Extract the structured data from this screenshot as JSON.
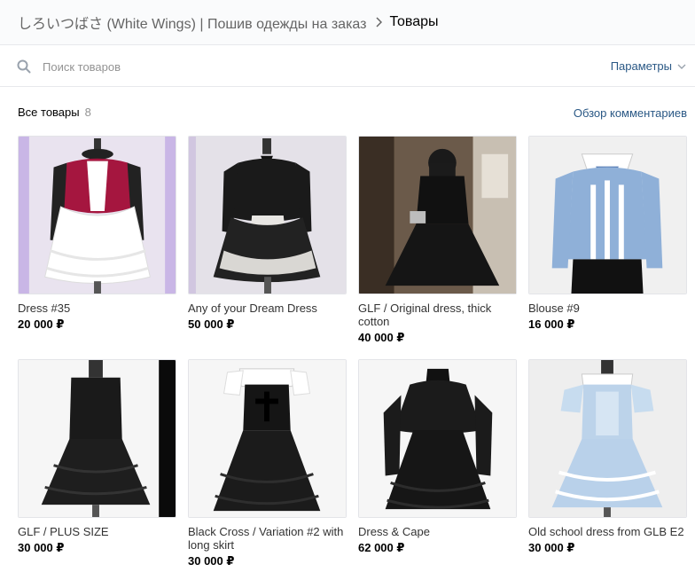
{
  "breadcrumb": {
    "group": "しろいつばさ (White Wings) | Пошив одежды на заказ",
    "current": "Товары"
  },
  "search": {
    "placeholder": "Поиск товаров",
    "params_label": "Параметры"
  },
  "section": {
    "title": "Все товары",
    "count": "8",
    "review_link": "Обзор комментариев"
  },
  "products": [
    {
      "title": "Dress #35",
      "price": "20 000 ₽"
    },
    {
      "title": "Any of your Dream Dress",
      "price": "50 000 ₽"
    },
    {
      "title": "GLF / Original dress, thick cotton",
      "price": "40 000 ₽"
    },
    {
      "title": "Blouse #9",
      "price": "16 000 ₽"
    },
    {
      "title": "GLF / PLUS SIZE",
      "price": "30 000 ₽"
    },
    {
      "title": "Black Cross / Variation #2 with long skirt",
      "price": "30 000 ₽"
    },
    {
      "title": "Dress & Cape",
      "price": "62 000 ₽"
    },
    {
      "title": "Old school dress from GLB E2",
      "price": "30 000 ₽"
    }
  ],
  "colors": {
    "link": "#2a5885",
    "muted": "#939393",
    "header_bg": "#fafbfc",
    "border": "#e7e8ec"
  }
}
